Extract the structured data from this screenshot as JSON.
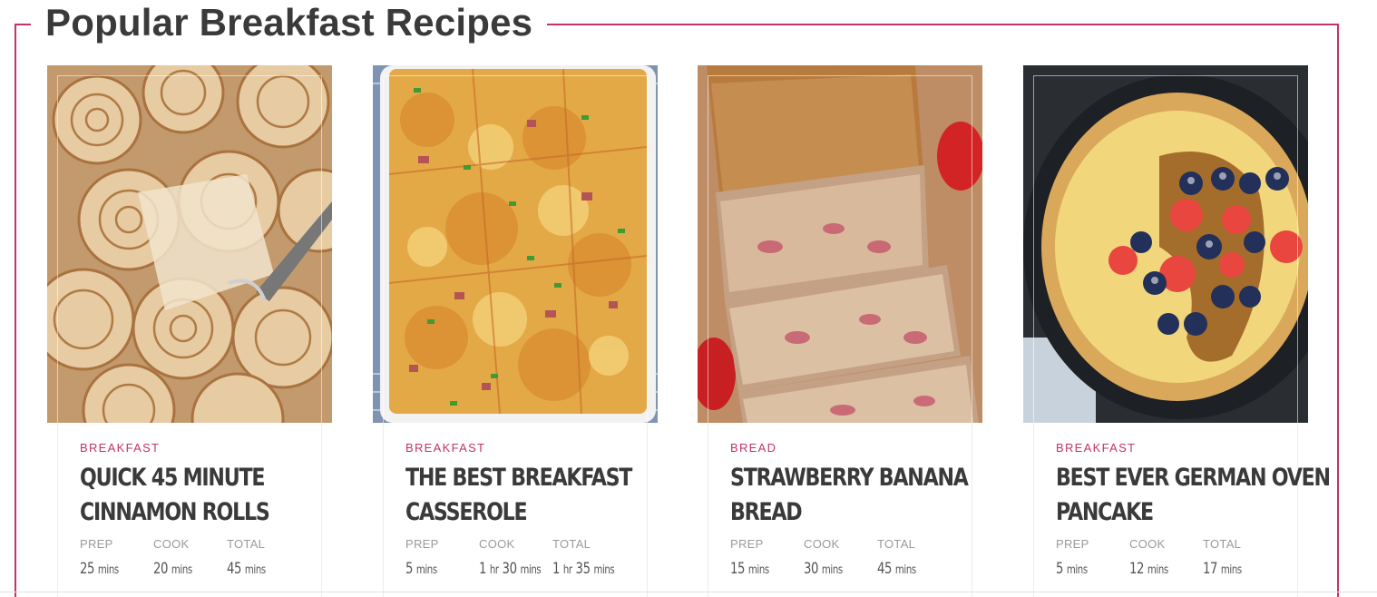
{
  "section": {
    "title": "Popular Breakfast Recipes",
    "accent_color": "#c2326b"
  },
  "labels": {
    "prep": "PREP",
    "cook": "COOK",
    "total": "TOTAL"
  },
  "cards": [
    {
      "category": "BREAKFAST",
      "title_line1": "QUICK 45 MINUTE",
      "title_line2": "CINNAMON ROLLS",
      "image": "cinnamon-rolls-photo",
      "prep": {
        "num": "25",
        "unit": "mins"
      },
      "cook": {
        "num": "20",
        "unit": "mins"
      },
      "total": {
        "num": "45",
        "unit": "mins"
      }
    },
    {
      "category": "BREAKFAST",
      "title_line1": "THE BEST BREAKFAST",
      "title_line2": "CASSEROLE",
      "image": "breakfast-casserole-photo",
      "prep": {
        "num": "5",
        "unit": "mins"
      },
      "cook": {
        "num": "1",
        "unit": "hr",
        "num2": "30",
        "unit2": "mins"
      },
      "total": {
        "num": "1",
        "unit": "hr",
        "num2": "35",
        "unit2": "mins"
      }
    },
    {
      "category": "BREAD",
      "title_line1": "STRAWBERRY BANANA",
      "title_line2": "BREAD",
      "image": "strawberry-banana-bread-photo",
      "prep": {
        "num": "15",
        "unit": "mins"
      },
      "cook": {
        "num": "30",
        "unit": "mins"
      },
      "total": {
        "num": "45",
        "unit": "mins"
      }
    },
    {
      "category": "BREAKFAST",
      "title_line1": "BEST EVER GERMAN OVEN",
      "title_line2": "PANCAKE",
      "image": "german-oven-pancake-photo",
      "prep": {
        "num": "5",
        "unit": "mins"
      },
      "cook": {
        "num": "12",
        "unit": "mins"
      },
      "total": {
        "num": "17",
        "unit": "mins"
      }
    }
  ]
}
